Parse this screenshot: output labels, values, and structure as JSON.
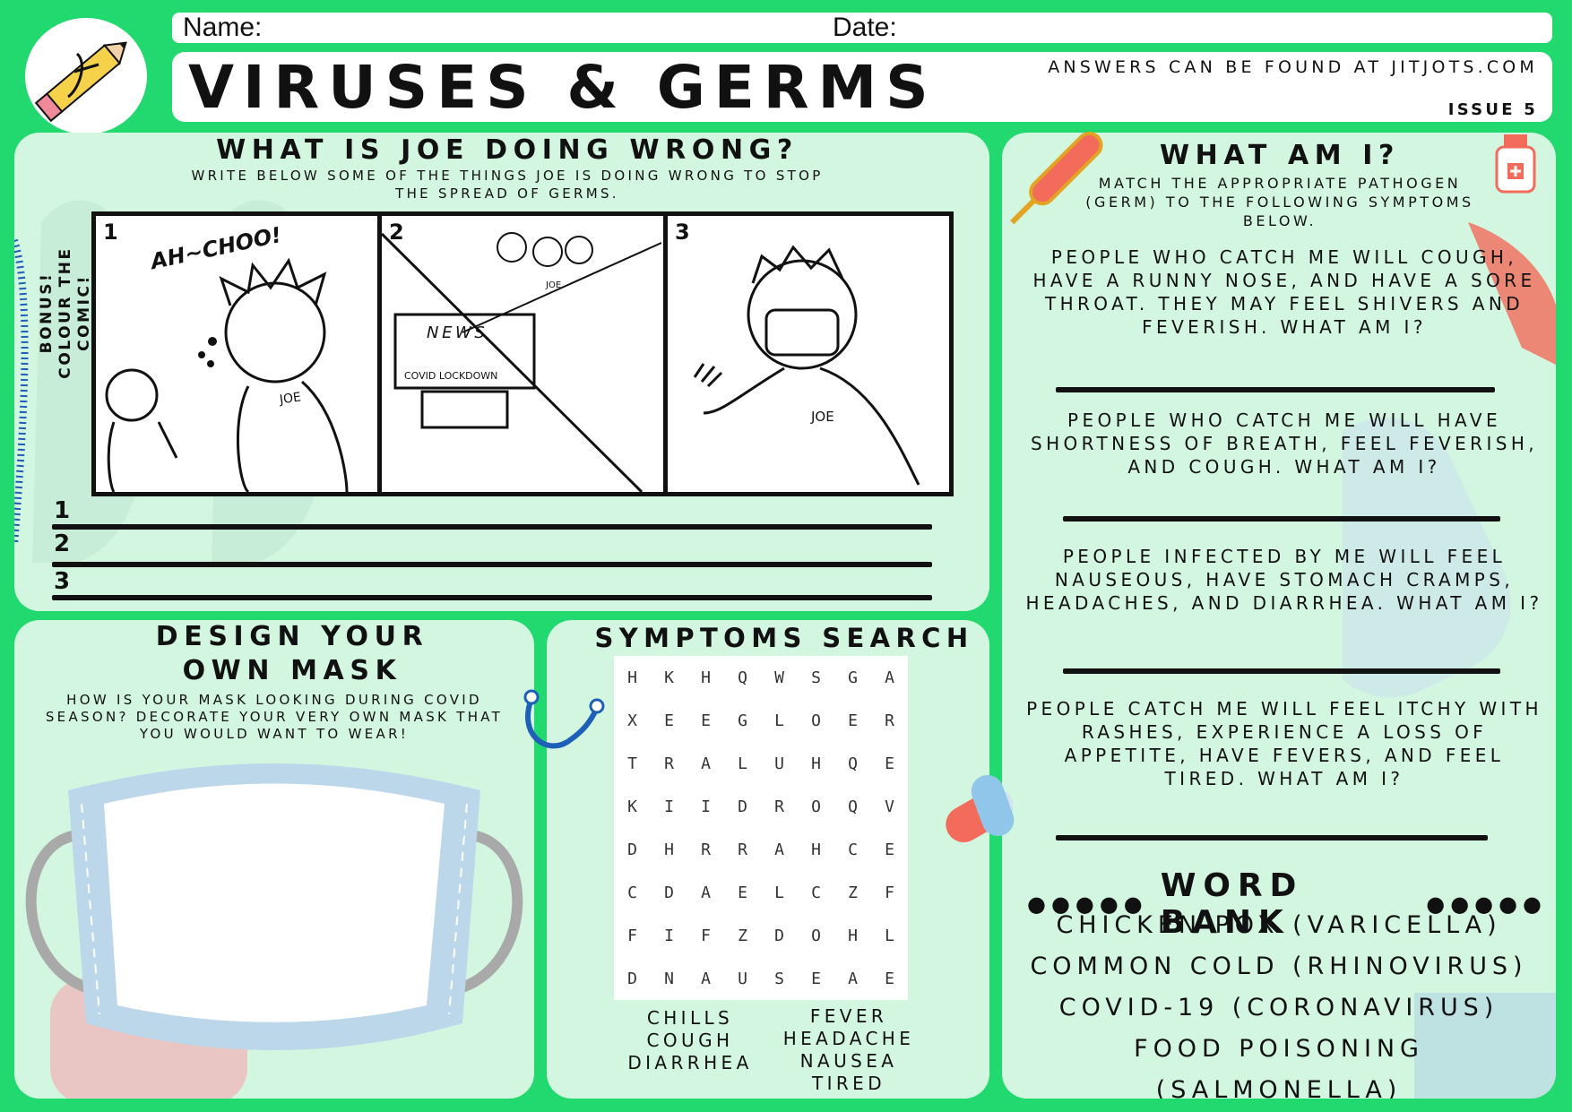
{
  "header": {
    "name_label": "Name:",
    "date_label": "Date:",
    "title": "VIRUSES & GERMS",
    "answers": "ANSWERS CAN BE FOUND AT JITJOTS.COM",
    "issue": "ISSUE 5"
  },
  "comic_section": {
    "title": "WHAT IS JOE DOING WRONG?",
    "instructions": "WRITE BELOW SOME OF THE THINGS JOE IS DOING WRONG TO STOP THE SPREAD OF GERMS.",
    "bonus": "BONUS! COLOUR THE COMIC!",
    "frames": [
      {
        "num": "1",
        "caption": "AH~CHOO!",
        "shirt": "JOE"
      },
      {
        "num": "2",
        "tv_title": "NEWS",
        "tv_caption": "COVID LOCKDOWN",
        "shirt": "JOE"
      },
      {
        "num": "3",
        "shirt": "JOE"
      }
    ],
    "blanks": [
      "1",
      "2",
      "3"
    ]
  },
  "mask_section": {
    "title_line1": "DESIGN YOUR",
    "title_line2": "OWN MASK",
    "instructions": "HOW IS YOUR MASK LOOKING DURING COVID SEASON? DECORATE YOUR VERY OWN MASK THAT YOU WOULD WANT TO WEAR!"
  },
  "search_section": {
    "title": "SYMPTOMS SEARCH",
    "grid": [
      [
        "H",
        "K",
        "H",
        "Q",
        "W",
        "S",
        "G",
        "A"
      ],
      [
        "X",
        "E",
        "E",
        "G",
        "L",
        "O",
        "E",
        "R"
      ],
      [
        "T",
        "R",
        "A",
        "L",
        "U",
        "H",
        "Q",
        "E"
      ],
      [
        "K",
        "I",
        "I",
        "D",
        "R",
        "O",
        "Q",
        "V"
      ],
      [
        "D",
        "H",
        "R",
        "R",
        "A",
        "H",
        "C",
        "E"
      ],
      [
        "C",
        "D",
        "A",
        "E",
        "L",
        "C",
        "Z",
        "F"
      ],
      [
        "F",
        "I",
        "F",
        "Z",
        "D",
        "O",
        "H",
        "L"
      ],
      [
        "D",
        "N",
        "A",
        "U",
        "S",
        "E",
        "A",
        "E"
      ]
    ],
    "words_left": [
      "CHILLS",
      "COUGH",
      "DIARRHEA"
    ],
    "words_right": [
      "FEVER",
      "HEADACHE",
      "NAUSEA",
      "TIRED"
    ]
  },
  "whatami_section": {
    "title": "WHAT AM I?",
    "instructions": "MATCH THE APPROPRIATE PATHOGEN (GERM) TO THE FOLLOWING SYMPTOMS BELOW.",
    "clues": [
      "PEOPLE WHO CATCH ME WILL COUGH, HAVE A RUNNY NOSE, AND HAVE A SORE THROAT. THEY MAY FEEL SHIVERS AND FEVERISH. WHAT AM I?",
      "PEOPLE WHO CATCH ME WILL HAVE SHORTNESS OF BREATH, FEEL FEVERISH, AND COUGH. WHAT AM I?",
      "PEOPLE INFECTED BY ME WILL FEEL NAUSEOUS, HAVE STOMACH CRAMPS, HEADACHES, AND DIARRHEA. WHAT AM I?",
      "PEOPLE CATCH ME WILL FEEL ITCHY WITH RASHES, EXPERIENCE A LOSS OF APPETITE, HAVE FEVERS, AND FEEL TIRED. WHAT AM I?"
    ],
    "word_bank_title": "WORD BANK",
    "word_bank": [
      "CHICKEN POX (VARICELLA)",
      "COMMON COLD (RHINOVIRUS)",
      "COVID-19 (CORONAVIRUS)",
      "FOOD POISONING (SALMONELLA)"
    ]
  },
  "colors": {
    "background": "#22d96f",
    "panel": "#d3f6e0",
    "ink": "#111111"
  }
}
